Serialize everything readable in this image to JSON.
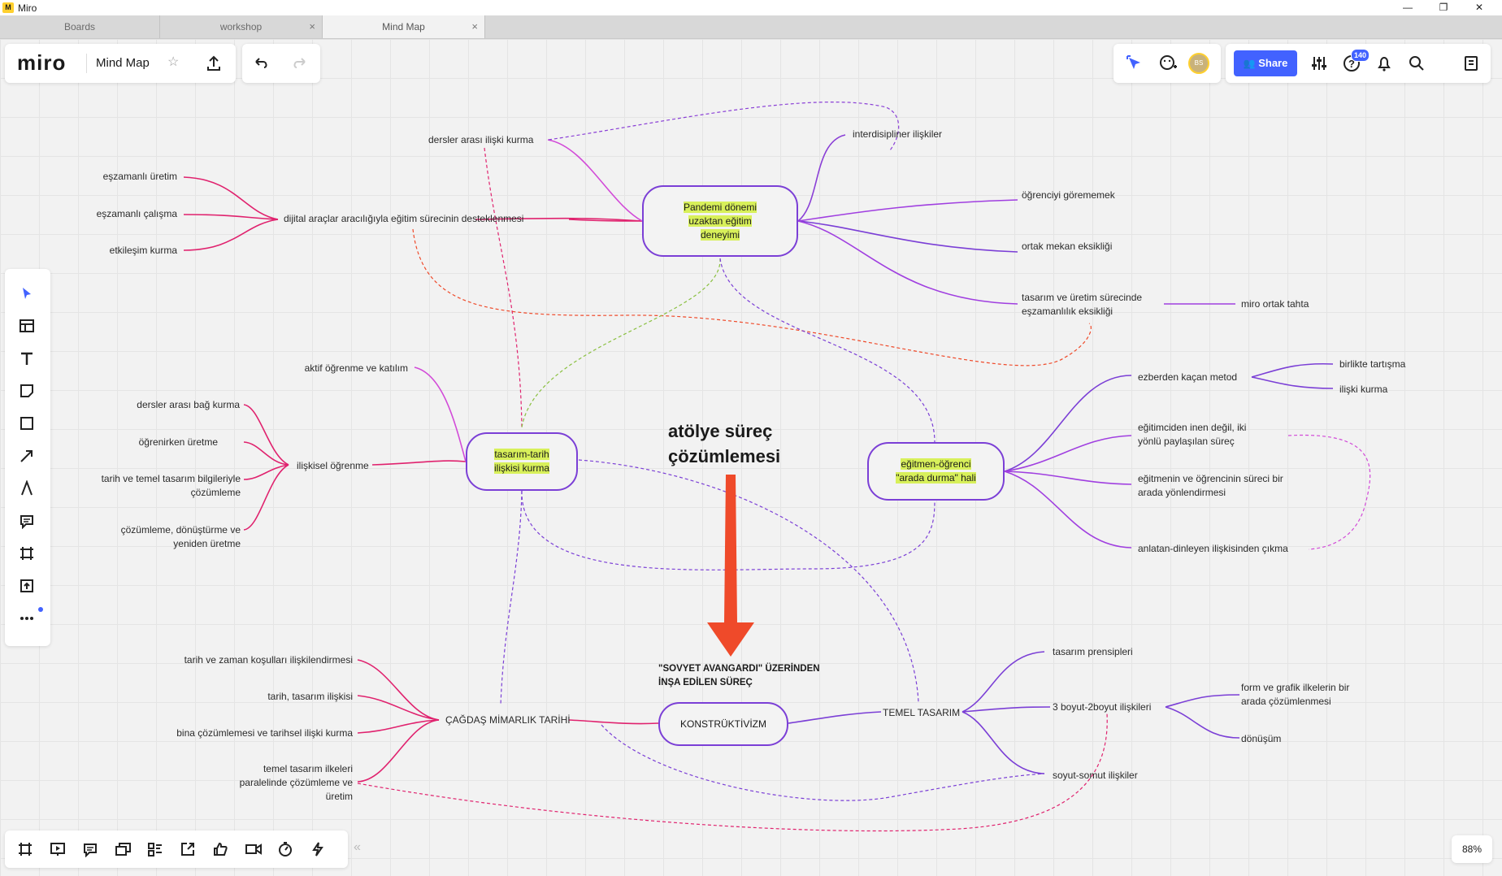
{
  "window": {
    "title": "Miro",
    "minimize": "—",
    "restore": "❐",
    "close": "✕"
  },
  "tabs": [
    {
      "label": "Boards"
    },
    {
      "label": "workshop",
      "close": "×"
    },
    {
      "label": "Mind Map",
      "close": "×"
    }
  ],
  "toolbar": {
    "logo": "miro",
    "board_name": "Mind Map",
    "share_label": "Share",
    "notification_count": "140",
    "avatar_initials": "BS",
    "zoom": "88%"
  },
  "icons": {
    "left_tools": [
      "select-icon",
      "templates-icon",
      "text-icon",
      "sticky-note-icon",
      "shape-icon",
      "connection-line-icon",
      "pen-icon",
      "comment-icon",
      "frame-icon",
      "upload-icon",
      "more-icon"
    ],
    "bottom_tools": [
      "frames-icon",
      "present-icon",
      "comments-icon",
      "cards-icon",
      "kanban-icon",
      "share-screen-icon",
      "reactions-icon",
      "video-icon",
      "timer-icon",
      "activity-icon",
      "collapse-icon"
    ]
  },
  "mindmap": {
    "center_title": [
      "atölye süreç",
      "çözümlemesi"
    ],
    "boxes": {
      "pandemi": [
        "Pandemi dönemi",
        "uzaktan eğitim",
        "deneyimi"
      ],
      "tasarim": [
        "tasarım-tarih",
        "ilişkisi kurma"
      ],
      "egitmen": [
        "eğitmen-öğrenci",
        "\"arada durma\" hali"
      ],
      "konstruktivizm": "KONSTRÜKTİVİZM"
    },
    "note": [
      "\"SOVYET AVANGARDI\" ÜZERİNDEN",
      "İNŞA EDİLEN SÜREÇ"
    ],
    "labels": {
      "dersler_arasi": "dersler arası ilişki kurma",
      "interdisipliner": "interdisipliner ilişkiler",
      "eszamanli_uretim": "eşzamanlı üretim",
      "eszamanli_calisma": "eşzamanlı çalışma",
      "etkilesim": "etkileşim kurma",
      "dijital": "dijital araçlar aracılığıyla eğitim sürecinin desteklenmesi",
      "ogrenciyi": "öğrenciyi görememek",
      "ortak_mekan": "ortak mekan eksikliği",
      "tasarim_uretim": [
        "tasarım ve üretim sürecinde",
        "eşzamanlılık eksikliği"
      ],
      "miro_ortak": "miro ortak tahta",
      "aktif": "aktif öğrenme ve katılım",
      "bag_kurma": "dersler arası bağ kurma",
      "ogrenirken": "öğrenirken üretme",
      "tarih_temel": [
        "tarih ve temel tasarım bilgileriyle",
        "çözümleme"
      ],
      "cozumleme": [
        "çözümleme, dönüştürme ve",
        "yeniden üretme"
      ],
      "iliskisel": "ilişkisel öğrenme",
      "ezberden": "ezberden kaçan metod",
      "birlikte": "birlikte tartışma",
      "iliski_kurma": "ilişki kurma",
      "egitimciden": [
        "eğitimciden inen değil, iki",
        "yönlü paylaşılan süreç"
      ],
      "egitmenin": [
        "eğitmenin ve öğrencinin süreci bir",
        "arada  yönlendirmesi"
      ],
      "anlatan": "anlatan-dinleyen ilişkisinden çıkma",
      "tarih_zaman": "tarih ve zaman koşulları ilişkilendirmesi",
      "tarih_tasarim": "tarih, tasarım ilişkisi",
      "bina": "bina çözümlemesi ve tarihsel ilişki kurma",
      "temel_ilkeleri": [
        "temel tasarım ilkeleri",
        "paralelinde çözümleme ve",
        "üretim"
      ],
      "cagdas": "ÇAĞDAŞ MİMARLIK TARİHİ",
      "temel_tasarim": "TEMEL TASARIM",
      "prensipleri": "tasarım prensipleri",
      "boyut": "3 boyut-2boyut ilişkileri",
      "form_grafik": [
        "form ve grafik ilkelerin bir",
        "arada çözümlenmesi"
      ],
      "donusum": "dönüşüm",
      "soyut": "soyut-somut ilişkiler"
    }
  },
  "colors": {
    "accent": "#4262ff",
    "box_border": "#7b3fd6",
    "highlight": "#d8f05a",
    "arrow": "#ef4a2a",
    "pink": "#e0226e",
    "purple": "#8a3fd6",
    "magenta": "#d24ad8"
  }
}
